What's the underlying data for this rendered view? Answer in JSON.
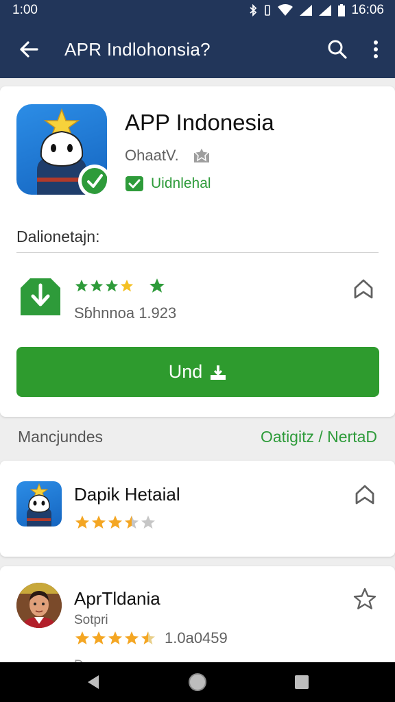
{
  "status_bar": {
    "time": "1:00",
    "clock": "16:06"
  },
  "app_bar": {
    "title": "APR Indlohonsia?"
  },
  "app": {
    "name": "APP Indonesia",
    "developer": "OhaatV.",
    "verified_label": "Uidnlehal",
    "section_label": "Dalionetajn:",
    "rating_count": "Sɓhnnoa 1.923",
    "install_label": "Und"
  },
  "recommendations_header": {
    "left": "Mancjundes",
    "right": "Oatigitz / NertaD"
  },
  "recommendations": [
    {
      "title": "Dapik Hetaial",
      "rating": 3.5
    },
    {
      "title": "AprTldania",
      "subtitle": "Sotpri",
      "rating": 4.5,
      "count": "1.0a0459",
      "partial": "D..."
    }
  ],
  "colors": {
    "app_bar": "#22365a",
    "accent_green": "#2e9b2e",
    "star": "#f4a623"
  },
  "icons": [
    "back-arrow-icon",
    "search-icon",
    "overflow-menu-icon",
    "download-icon",
    "bookmark-icon",
    "back-nav-icon",
    "home-nav-icon",
    "recents-nav-icon"
  ]
}
